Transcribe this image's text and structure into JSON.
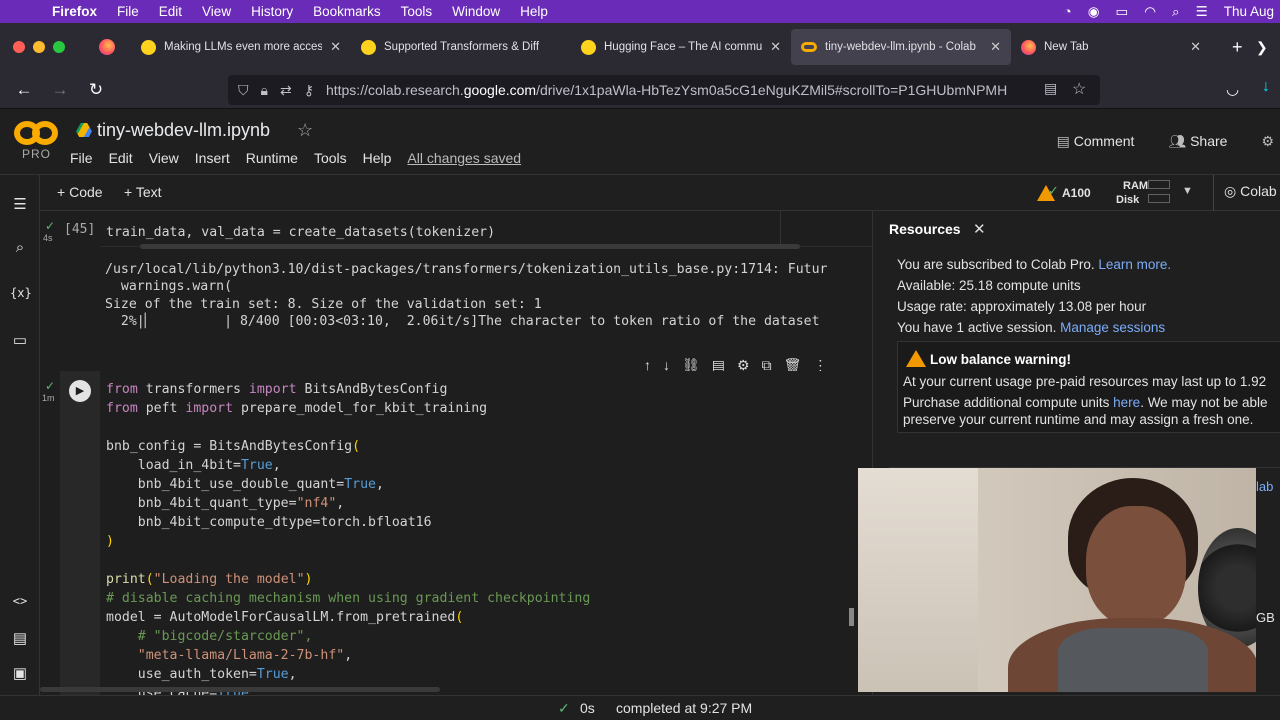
{
  "menubar": {
    "app": "Firefox",
    "items": [
      "File",
      "Edit",
      "View",
      "History",
      "Bookmarks",
      "Tools",
      "Window",
      "Help"
    ],
    "clock": "Thu Aug"
  },
  "tabs": [
    {
      "label": "Making LLMs even more acces",
      "icon": "hugging-face-icon"
    },
    {
      "label": "Supported Transformers & Diff",
      "icon": "hugging-face-icon"
    },
    {
      "label": "Hugging Face – The AI commu",
      "icon": "hugging-face-icon"
    },
    {
      "label": "tiny-webdev-llm.ipynb - Colab",
      "icon": "colab-icon",
      "active": true
    },
    {
      "label": "New Tab",
      "icon": "firefox-icon"
    }
  ],
  "url": {
    "prefix": "https://colab.research.",
    "domain": "google.com",
    "path": "/drive/1x1paWla-HbTezYsm0a5cG1eNguKZMil5#scrollTo=P1GHUbmNPMH"
  },
  "colab": {
    "logo_label": "PRO",
    "title": "tiny-webdev-llm.ipynb",
    "menu": [
      "File",
      "Edit",
      "View",
      "Insert",
      "Runtime",
      "Tools",
      "Help"
    ],
    "saved": "All changes saved",
    "comment": "Comment",
    "share": "Share",
    "add_code": "Code",
    "add_text": "Text",
    "gpu": "A100",
    "ram": "RAM",
    "disk": "Disk",
    "connect_label": "Colab"
  },
  "cell1": {
    "exec_count": "[45]",
    "time": "4s",
    "code": "train_data, val_data = create_datasets(tokenizer)",
    "output": [
      "/usr/local/lib/python3.10/dist-packages/transformers/tokenization_utils_base.py:1714: Futur",
      "  warnings.warn(",
      "Size of the train set: 8. Size of the validation set: 1",
      "  2%|▏         | 8/400 [00:03<03:10,  2.06it/s]The character to token ratio of the dataset"
    ]
  },
  "cell2": {
    "time": "1m",
    "lines": {
      "l1_kw1": "from",
      "l1_mod": " transformers ",
      "l1_kw2": "import",
      "l1_name": " BitsAndBytesConfig",
      "l2_kw1": "from",
      "l2_mod": " peft ",
      "l2_kw2": "import",
      "l2_name": " prepare_model_for_kbit_training",
      "l4": "bnb_config = BitsAndBytesConfig",
      "l5a": "    load_in_4bit=",
      "l5b": "True",
      "l5c": ",",
      "l6a": "    bnb_4bit_use_double_quant=",
      "l6b": "True",
      "l6c": ",",
      "l7a": "    bnb_4bit_quant_type=",
      "l7b": "\"nf4\"",
      "l7c": ",",
      "l8": "    bnb_4bit_compute_dtype=torch.bfloat16",
      "l11a": "print",
      "l11b": "\"Loading the model\"",
      "l12": "# disable caching mechanism when using gradient checkpointing",
      "l13": "model = AutoModelForCausalLM.from_pretrained",
      "l14": "    # \"bigcode/starcoder\",",
      "l15": "\"meta-llama/Llama-2-7b-hf\"",
      "l16a": "    use_auth_token=",
      "l16b": "True",
      "l16c": ",",
      "l17a": "    use_cache=",
      "l17b": "True"
    }
  },
  "resources": {
    "title": "Resources",
    "line1": "You are subscribed to Colab Pro.",
    "line1_link": "Learn more.",
    "line2": "Available: 25.18 compute units",
    "line3": "Usage rate: approximately 13.08 per hour",
    "line4": "You have 1 active session.",
    "line4_link": "Manage sessions",
    "warn_title": "Low balance warning!",
    "warn1": "At your current usage pre-paid resources may last up to 1.92",
    "warn2a": "Purchase additional compute units",
    "warn2_link": "here",
    "warn2b": ". We may not be able",
    "warn3": "preserve your current runtime and may assign a fresh one.",
    "peek_lab": "lab",
    "peek_gb": "GB"
  },
  "status": {
    "time": "0s",
    "text": "completed at 9:27 PM"
  }
}
